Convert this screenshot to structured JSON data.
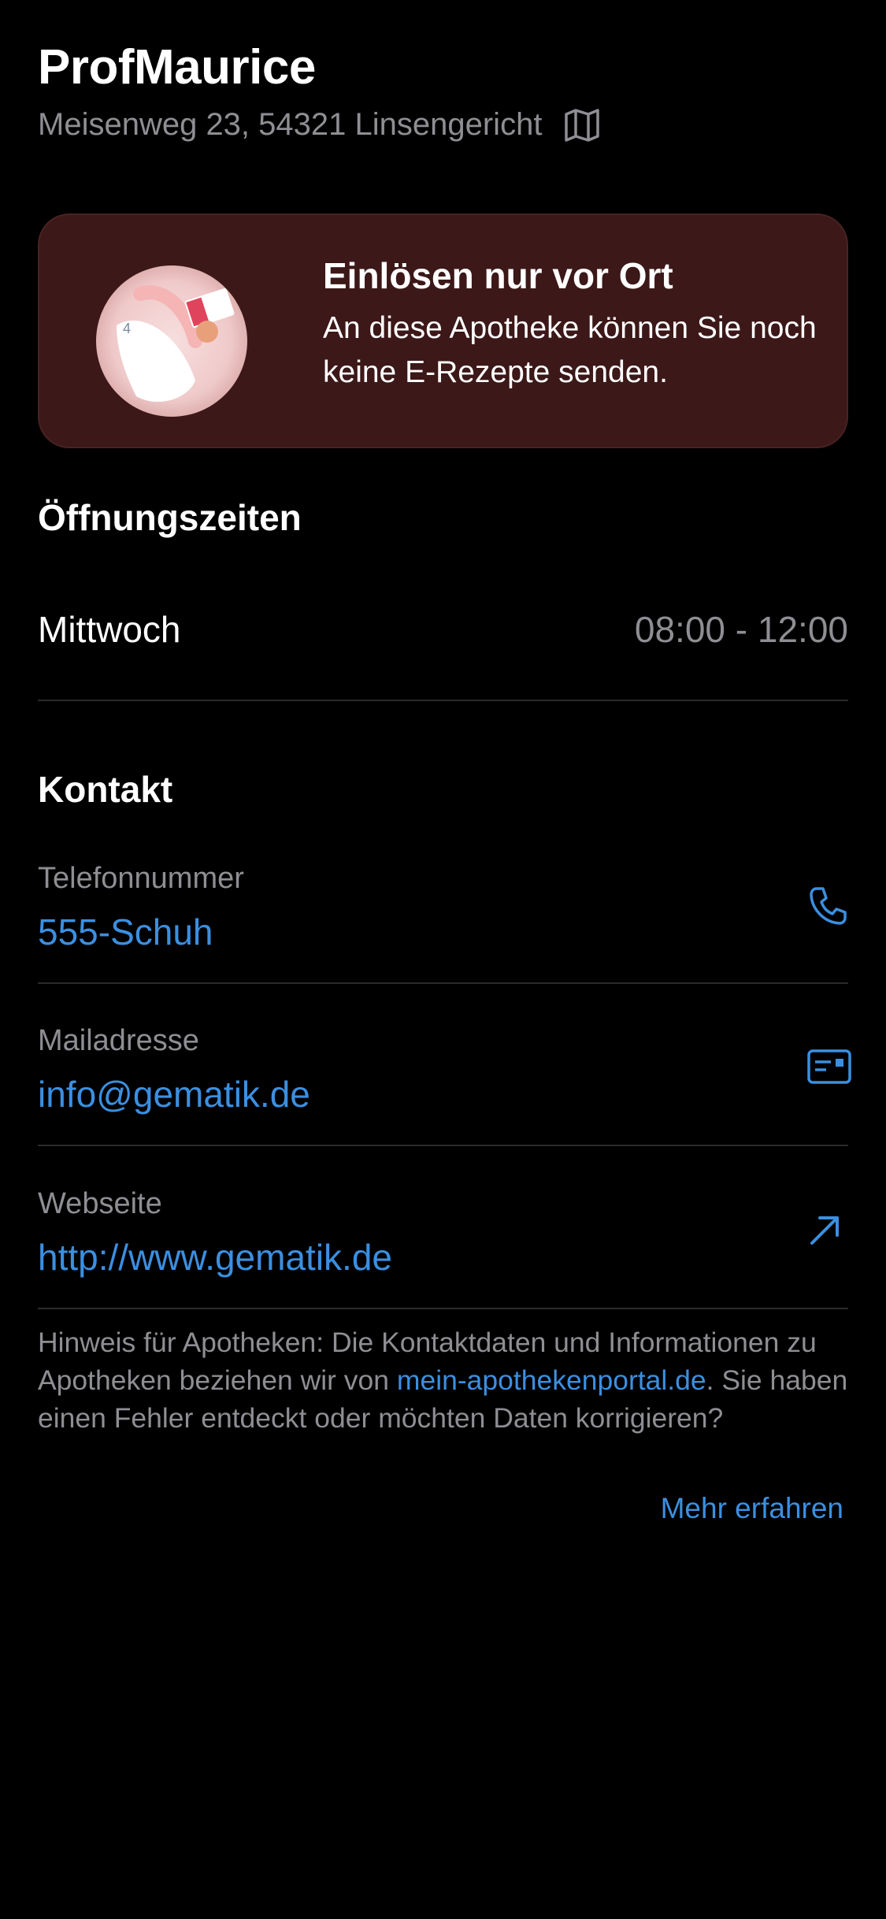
{
  "header": {
    "title": "ProfMaurice",
    "address": "Meisenweg 23, 54321 Linsengericht",
    "map_icon": "map-icon"
  },
  "banner": {
    "title": "Einlösen nur vor Ort",
    "text": "An diese Apotheke können Sie noch keine E-Rezepte senden.",
    "bg_color": "#3c1818"
  },
  "opening_hours": {
    "title": "Öffnungszeiten",
    "rows": [
      {
        "day": "Mittwoch",
        "time": "08:00 - 12:00"
      }
    ]
  },
  "contact": {
    "title": "Kontakt",
    "phone": {
      "label": "Telefonnummer",
      "value": "555-Schuh",
      "icon": "phone-icon"
    },
    "mail": {
      "label": "Mailadresse",
      "value": "info@gematik.de",
      "icon": "mail-icon"
    },
    "web": {
      "label": "Webseite",
      "value": "http://www.gematik.de",
      "icon": "external-link-icon"
    }
  },
  "hint": {
    "text_before": "Hinweis für Apotheken: Die Kontaktdaten und Informationen zu Apotheken beziehen wir von ",
    "link": "mein-apothekenportal.de",
    "text_after": ". Sie haben einen Fehler entdeckt oder möchten Daten korrigieren?",
    "more_label": "Mehr erfahren"
  },
  "colors": {
    "accent": "#3b8fe0",
    "secondary_text": "#8e8e93",
    "background": "#000000"
  }
}
